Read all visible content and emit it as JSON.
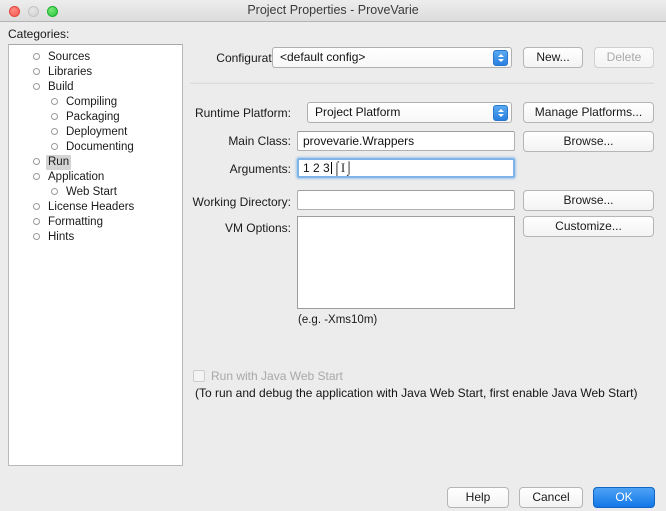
{
  "window": {
    "title": "Project Properties - ProveVarie",
    "controls": [
      {
        "name": "close-button",
        "color": "#f4584f"
      },
      {
        "name": "minimize-button",
        "color": "#d2d2d2"
      },
      {
        "name": "zoom-button",
        "color": "#27c43a"
      }
    ]
  },
  "sidebar": {
    "heading": "Categories:",
    "items": [
      {
        "label": "Sources",
        "level": 1,
        "twisty": false,
        "selected": false
      },
      {
        "label": "Libraries",
        "level": 1,
        "twisty": false,
        "selected": false
      },
      {
        "label": "Build",
        "level": 1,
        "twisty": true,
        "selected": false
      },
      {
        "label": "Compiling",
        "level": 2,
        "twisty": false,
        "selected": false
      },
      {
        "label": "Packaging",
        "level": 2,
        "twisty": false,
        "selected": false
      },
      {
        "label": "Deployment",
        "level": 2,
        "twisty": false,
        "selected": false
      },
      {
        "label": "Documenting",
        "level": 2,
        "twisty": false,
        "selected": false
      },
      {
        "label": "Run",
        "level": 1,
        "twisty": false,
        "selected": true
      },
      {
        "label": "Application",
        "level": 1,
        "twisty": true,
        "selected": false
      },
      {
        "label": "Web Start",
        "level": 2,
        "twisty": false,
        "selected": false
      },
      {
        "label": "License Headers",
        "level": 1,
        "twisty": false,
        "selected": false
      },
      {
        "label": "Formatting",
        "level": 1,
        "twisty": false,
        "selected": false
      },
      {
        "label": "Hints",
        "level": 1,
        "twisty": false,
        "selected": false
      }
    ]
  },
  "form": {
    "configuration": {
      "label": "Configuration:",
      "value": "<default config>",
      "new_button": "New...",
      "delete_button": "Delete",
      "delete_enabled": false
    },
    "runtime_platform": {
      "label": "Runtime Platform:",
      "value": "Project Platform",
      "manage_button": "Manage Platforms..."
    },
    "main_class": {
      "label": "Main Class:",
      "value": "provevarie.Wrappers",
      "placeholder": "",
      "browse_button": "Browse..."
    },
    "arguments": {
      "label": "Arguments:",
      "value": "1 2 3",
      "placeholder": "",
      "focused": true
    },
    "working_directory": {
      "label": "Working Directory:",
      "value": "",
      "placeholder": "",
      "browse_button": "Browse..."
    },
    "vm_options": {
      "label": "VM Options:",
      "value": "",
      "hint": "(e.g. -Xms10m)",
      "customize_button": "Customize..."
    },
    "web_start": {
      "checkbox_label": "Run with Java Web Start",
      "checked": false,
      "enabled": false,
      "note": "(To run and debug the application with Java Web Start, first enable Java Web Start)"
    }
  },
  "footer": {
    "help_button": "Help",
    "cancel_button": "Cancel",
    "ok_button": "OK"
  },
  "colors": {
    "accent": "#1277e8",
    "window_bg": "#ececec",
    "field_bg": "#ffffff",
    "focus_ring": "#7eb4ea",
    "selection": "#d4d4d4"
  }
}
